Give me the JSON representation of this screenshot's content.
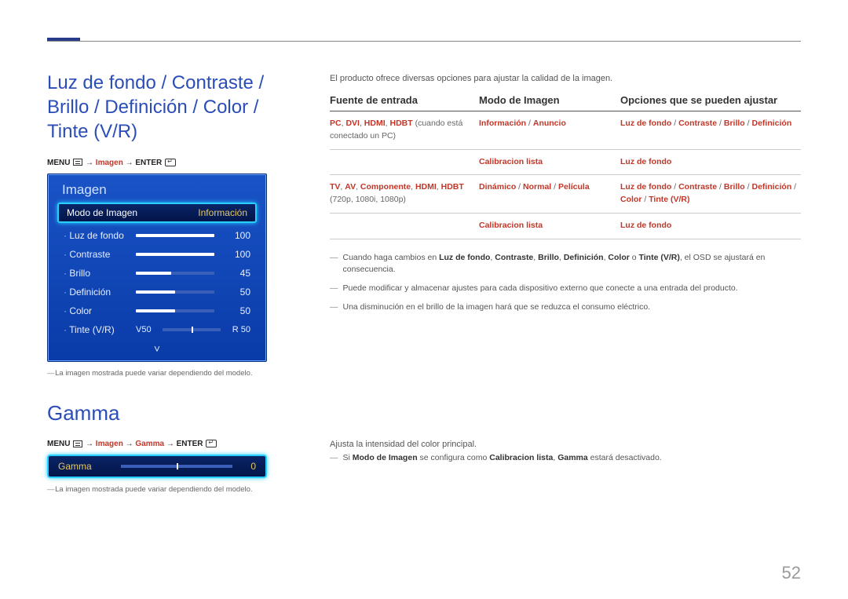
{
  "section1_title": "Luz de fondo / Contraste / Brillo / Definición / Color / Tinte (V/R)",
  "menu_path1": {
    "menu": "MENU",
    "arrow": "→",
    "imagen": "Imagen",
    "enter": "ENTER"
  },
  "osd": {
    "title": "Imagen",
    "highlight_label": "Modo de Imagen",
    "highlight_value": "Información",
    "rows": [
      {
        "label": "Luz de fondo",
        "value": "100",
        "pct": 100
      },
      {
        "label": "Contraste",
        "value": "100",
        "pct": 100
      },
      {
        "label": "Brillo",
        "value": "45",
        "pct": 45
      },
      {
        "label": "Definición",
        "value": "50",
        "pct": 50
      },
      {
        "label": "Color",
        "value": "50",
        "pct": 50
      }
    ],
    "tinte_label": "Tinte (V/R)",
    "tinte_v": "V50",
    "tinte_r": "R 50",
    "chevron": "˅"
  },
  "note1": "La imagen mostrada puede variar dependiendo del modelo.",
  "gamma_title": "Gamma",
  "menu_path2": {
    "menu": "MENU",
    "arrow": "→",
    "imagen": "Imagen",
    "gamma": "Gamma",
    "enter": "ENTER"
  },
  "gamma_panel": {
    "label": "Gamma",
    "value": "0"
  },
  "note2": "La imagen mostrada puede variar dependiendo del modelo.",
  "intro": "El producto ofrece diversas opciones para ajustar la calidad de la imagen.",
  "table": {
    "h1": "Fuente de entrada",
    "h2": "Modo de Imagen",
    "h3": "Opciones que se pueden ajustar",
    "rows": [
      {
        "c1a": "PC",
        "c1b": ", ",
        "c1c": "DVI",
        "c1d": ", ",
        "c1e": "HDMI",
        "c1f": ", ",
        "c1g": "HDBT",
        "c1h": " (cuando está conectado un PC)",
        "c2a": "Información",
        "c2b": " / ",
        "c2c": "Anuncio",
        "c3a": "Luz de fondo",
        "c3b": " / ",
        "c3c": "Contraste",
        "c3d": " / ",
        "c3e": "Brillo",
        "c3f": " / ",
        "c3g": "Definición"
      },
      {
        "c1": "",
        "c2": "Calibracion lista",
        "c3": "Luz de fondo"
      },
      {
        "c1a": "TV",
        "c1b": ", ",
        "c1c": "AV",
        "c1d": ", ",
        "c1e": "Componente",
        "c1f": ", ",
        "c1g": "HDMI",
        "c1h": ", ",
        "c1i": "HDBT",
        "c1j": " (720p, 1080i, 1080p)",
        "c2a": "Dinámico",
        "c2b": " / ",
        "c2c": "Normal",
        "c2d": " / ",
        "c2e": "Película",
        "c3a": "Luz de fondo",
        "c3b": " / ",
        "c3c": "Contraste",
        "c3d": " / ",
        "c3e": "Brillo",
        "c3f": " / ",
        "c3g": "Definición",
        "c3h": " / ",
        "c3i": "Color",
        "c3j": " / ",
        "c3k": "Tinte (V/R)"
      },
      {
        "c1": "",
        "c2": "Calibracion lista",
        "c3": "Luz de fondo"
      }
    ]
  },
  "bullets": [
    {
      "pre": "Cuando haga cambios en ",
      "b1": "Luz de fondo",
      "s1": ", ",
      "b2": "Contraste",
      "s2": ", ",
      "b3": "Brillo",
      "s3": ", ",
      "b4": "Definición",
      "s4": ", ",
      "b5": "Color",
      "s5": " o ",
      "b6": "Tinte (V/R)",
      "post": ", el OSD se ajustará en consecuencia."
    },
    {
      "text": "Puede modificar y almacenar ajustes para cada dispositivo externo que conecte a una entrada del producto."
    },
    {
      "text": "Una disminución en el brillo de la imagen hará que se reduzca el consumo eléctrico."
    }
  ],
  "gamma_desc": {
    "line1": "Ajusta la intensidad del color principal.",
    "line2a": "Si ",
    "line2b": "Modo de Imagen",
    "line2c": " se configura como ",
    "line2d": "Calibracion lista",
    "line2e": ", ",
    "line2f": "Gamma",
    "line2g": " estará desactivado."
  },
  "page_num": "52"
}
